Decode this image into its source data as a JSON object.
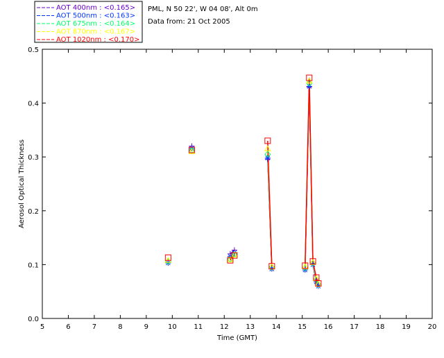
{
  "header": {
    "site": "PML, N 50 22', W 04 08', Alt 0m",
    "date": "Data from: 21 Oct 2005"
  },
  "chart_data": {
    "type": "line",
    "xlabel": "Time (GMT)",
    "ylabel": "Aerosol Optical Thickness",
    "xlim": [
      5,
      20
    ],
    "ylim": [
      0,
      0.5
    ],
    "xticks": [
      "5",
      "6",
      "7",
      "8",
      "9",
      "10",
      "11",
      "12",
      "13",
      "14",
      "15",
      "16",
      "17",
      "18",
      "19",
      "20"
    ],
    "yticks": [
      "0.0",
      "0.1",
      "0.2",
      "0.3",
      "0.4",
      "0.5"
    ],
    "legend_position": "top-left",
    "x": [
      9.84,
      10.75,
      12.23,
      12.39,
      13.67,
      13.83,
      15.11,
      15.27,
      15.41,
      15.54,
      15.62
    ],
    "series": [
      {
        "name": "AOT  400nm : <0.165>",
        "color": "#6600cc",
        "marker": "plus",
        "values": [
          0.104,
          0.32,
          0.12,
          0.127,
          0.296,
          0.093,
          0.092,
          0.43,
          0.101,
          0.07,
          0.062
        ]
      },
      {
        "name": "AOT  500nm : <0.163>",
        "color": "#0033ff",
        "marker": "asterisk",
        "values": [
          0.103,
          0.316,
          0.115,
          0.122,
          0.298,
          0.092,
          0.09,
          0.431,
          0.1,
          0.068,
          0.06
        ]
      },
      {
        "name": "AOT  675nm : <0.164>",
        "color": "#00ff66",
        "marker": "diamond",
        "values": [
          0.106,
          0.312,
          0.11,
          0.119,
          0.305,
          0.095,
          0.094,
          0.437,
          0.103,
          0.072,
          0.063
        ]
      },
      {
        "name": "AOT  870nm : <0.167>",
        "color": "#ffff00",
        "marker": "triangle",
        "values": [
          0.108,
          0.31,
          0.109,
          0.118,
          0.315,
          0.096,
          0.096,
          0.441,
          0.104,
          0.074,
          0.064
        ]
      },
      {
        "name": "AOT 1020nm : <0.170>",
        "color": "#ff0000",
        "marker": "square",
        "values": [
          0.113,
          0.313,
          0.108,
          0.117,
          0.33,
          0.097,
          0.098,
          0.447,
          0.106,
          0.076,
          0.065
        ]
      }
    ]
  }
}
